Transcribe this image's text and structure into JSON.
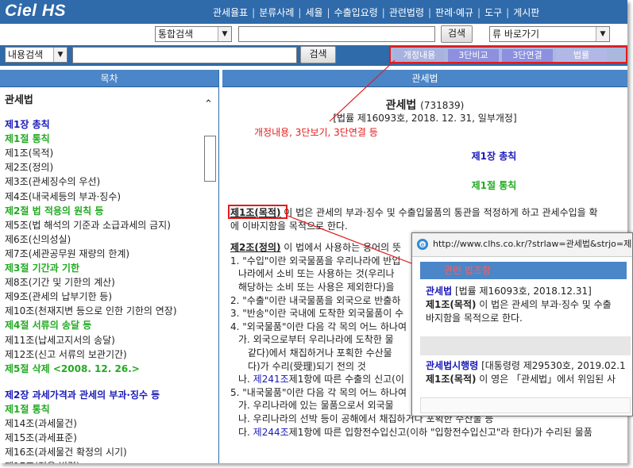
{
  "app": {
    "logo": "Ciel HS"
  },
  "topnav": [
    "관세율표",
    "분류사례",
    "세율",
    "수출입요령",
    "관련법령",
    "판례·예규",
    "도구",
    "게시판"
  ],
  "search1": {
    "type": "통합검색",
    "button": "검색",
    "quick": "류 바로가기"
  },
  "search2": {
    "type": "내용검색",
    "button": "검색"
  },
  "tabs": [
    "개정내용",
    "3단비교",
    "3단연결",
    "법률"
  ],
  "left": {
    "header": "목차",
    "title": "관세법",
    "items": [
      {
        "k": "ch",
        "t": "제1장 총칙"
      },
      {
        "k": "se",
        "t": "제1절 통칙"
      },
      {
        "k": "ar",
        "t": "제1조(목적)"
      },
      {
        "k": "ar",
        "t": "제2조(정의)"
      },
      {
        "k": "ar",
        "t": "제3조(관세징수의 우선)"
      },
      {
        "k": "ar",
        "t": "제4조(내국세등의 부과·징수)"
      },
      {
        "k": "se",
        "t": "제2절 법 적용의 원칙 등"
      },
      {
        "k": "ar",
        "t": "제5조(법 해석의 기준과 소급과세의 금지)"
      },
      {
        "k": "ar",
        "t": "제6조(신의성실)"
      },
      {
        "k": "ar",
        "t": "제7조(세관공무원 재량의 한계)"
      },
      {
        "k": "se",
        "t": "제3절 기간과 기한"
      },
      {
        "k": "ar",
        "t": "제8조(기간 및 기한의 계산)"
      },
      {
        "k": "ar",
        "t": "제9조(관세의 납부기한 등)"
      },
      {
        "k": "ar",
        "t": "제10조(천재지변 등으로 인한 기한의 연장)"
      },
      {
        "k": "se",
        "t": "제4절 서류의 송달 등"
      },
      {
        "k": "ar",
        "t": "제11조(납세고지서의 송달)"
      },
      {
        "k": "ar",
        "t": "제12조(신고 서류의 보관기간)"
      },
      {
        "k": "se",
        "t": "제5절 삭제 <2008. 12. 26.>"
      }
    ],
    "items2": [
      {
        "k": "ch",
        "t": "제2장 과세가격과 관세의 부과·징수 등"
      },
      {
        "k": "se",
        "t": "제1절 통칙"
      },
      {
        "k": "ar",
        "t": "제14조(과세물건)"
      },
      {
        "k": "ar",
        "t": "제15조(과세표준)"
      },
      {
        "k": "ar",
        "t": "제16조(과세물건 확정의 시기)"
      },
      {
        "k": "ar",
        "t": "제17조(적용 법령)"
      }
    ]
  },
  "right": {
    "header": "관세법",
    "law_title": "관세법",
    "law_id": "(731839)",
    "law_sub": "[법률 제16093호, 2018. 12. 31, 일부개정]",
    "annotation": "개정내용, 3단보기, 3단연결 등",
    "chapter": "제1장 총칙",
    "section": "제1절 통칙",
    "art1_label": "제1조(목적)",
    "art1_text": " 이 법은 관세의 부과·징수 및 수출입물품의 통관을 적정하게 하고 관세수입을 확",
    "art1_cont": "에 이바지함을 목적으로 한다.",
    "art2_label": "제2조(정의)",
    "art2_text": " 이 법에서 사용하는 용어의 뜻",
    "lines": [
      {
        "c": "ind1",
        "t": "1. \"수입\"이란 외국물품을 우리나라에 반입"
      },
      {
        "c": "ind2",
        "t": "나라에서 소비 또는 사용하는 것(우리나"
      },
      {
        "c": "ind2",
        "t": "해당하는 소비 또는 사용은 제외한다)을"
      },
      {
        "c": "ind1",
        "t": "2. \"수출\"이란 내국물품을 외국으로 반출하"
      },
      {
        "c": "ind1",
        "t": "3. \"반송\"이란 국내에 도착한 외국물품이 수"
      },
      {
        "c": "ind1",
        "t": "4. \"외국물품\"이란 다음 각 목의 어느 하나여"
      },
      {
        "c": "ind2",
        "t": "가. 외국으로부터 우리나라에 도착한 물"
      },
      {
        "c": "ind3",
        "t": "같다)에서 채집하거나 포획한 수산물"
      },
      {
        "c": "ind3",
        "t": "다)가 수리(受理)되기 전의 것"
      },
      {
        "c": "ind2",
        "t": "나. 제241조제1항에 따른 수출의 신고(이"
      },
      {
        "c": "ind1",
        "t": "5. \"내국물품\"이란 다음 각 목의 어느 하나여"
      },
      {
        "c": "ind2",
        "t": "가. 우리나라에 있는 물품으로서 외국물"
      },
      {
        "c": "ind2",
        "t": "나. 우리나라의 선박 등이 공해에서 채집하거나 포획한 수산물 등"
      },
      {
        "c": "ind2",
        "t": "다. 제244조제1항에 따른 입항전수입신고(이하 \"입항전수입신고\"라 한다)가 수리된 물품"
      }
    ]
  },
  "popup": {
    "url": "http://www.clhs.co.kr/?strlaw=관세법&strjo=제",
    "bar": "관련 법조항",
    "b1_law": "관세법",
    "b1_ref": " [법률 제16093호, 2018.12.31]",
    "b1_art": "제1조(목적)",
    "b1_text": " 이 법은 관세의 부과·징수 및 수출",
    "b1_cont": "바지함을 목적으로 한다.",
    "b2_law": "관세법시행령",
    "b2_ref": " [대통령령 제29530호, 2019.02.1",
    "b2_art": "제1조(목적)",
    "b2_text": " 이 영은 「관세법」에서 위임된 사"
  }
}
